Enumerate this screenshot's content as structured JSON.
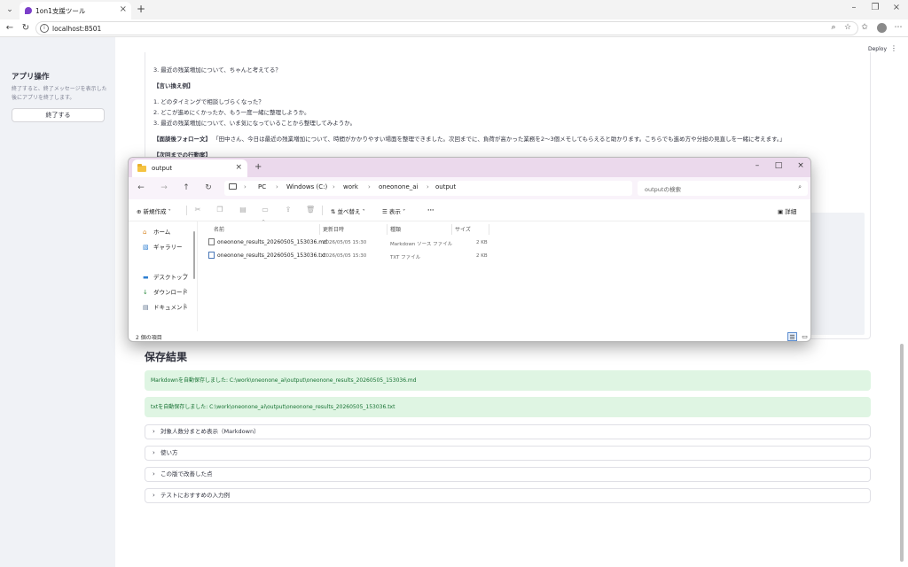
{
  "browser": {
    "tab_title": "1on1支援ツール",
    "url": "localhost:8501"
  },
  "app": {
    "deploy_label": "Deploy",
    "sidebar": {
      "title": "アプリ操作",
      "description": "終了すると、終了メッセージを表示した後にアプリを終了します。",
      "button": "終了する"
    },
    "content": {
      "line_top": "3. 最近の残業増加について、ちゃんと考えてる？",
      "rephrase_heading": "【言い換え例】",
      "rephrase": [
        "1. どのタイミングで相談しづらくなった？",
        "2. どこが進めにくかったか、もう一度一緒に整理しようか。",
        "3. 最近の残業増加について、いま気になっていることから整理してみようか。"
      ],
      "followup_label": "【面談後フォロー文】",
      "followup_text": "「田中さん、今日は最近の残業増加について、時間がかかりやすい場面を整理できました。次回までに、負荷が高かった業務を2〜3個メモしてもらえると助かります。こちらでも進め方や分担の見直しを一緒に考えます。」",
      "next_action_heading": "【次回までの行動案】"
    },
    "result": {
      "heading": "保存結果",
      "md_saved": "Markdownを自動保存しました: C:\\work\\oneonone_ai\\output\\oneonone_results_20260505_153036.md",
      "txt_saved": "txtを自動保存しました: C:\\work\\oneonone_ai\\output\\oneonone_results_20260505_153036.txt"
    },
    "expanders": [
      "対象人数分まとめ表示（Markdown）",
      "使い方",
      "この版で改善した点",
      "テストにおすすめの入力例"
    ]
  },
  "explorer": {
    "tab_title": "output",
    "breadcrumbs": [
      "PC",
      "Windows (C:)",
      "work",
      "oneonone_ai",
      "output"
    ],
    "search_placeholder": "outputの検索",
    "toolbar": {
      "new": "新規作成",
      "sort": "並べ替え",
      "view": "表示",
      "more": "···",
      "details": "詳細"
    },
    "nav": {
      "home": "ホーム",
      "gallery": "ギャラリー",
      "desktop": "デスクトップ",
      "downloads": "ダウンロード",
      "documents": "ドキュメント"
    },
    "columns": {
      "name": "名前",
      "modified": "更新日時",
      "type": "種類",
      "size": "サイズ"
    },
    "files": [
      {
        "name": "oneonone_results_20260505_153036.md",
        "modified": "2026/05/05 15:30",
        "type": "Markdown ソース ファイル",
        "size": "2 KB"
      },
      {
        "name": "oneonone_results_20260505_153036.txt",
        "modified": "2026/05/05 15:30",
        "type": "TXT ファイル",
        "size": "2 KB"
      }
    ],
    "status": "2 個の項目"
  }
}
